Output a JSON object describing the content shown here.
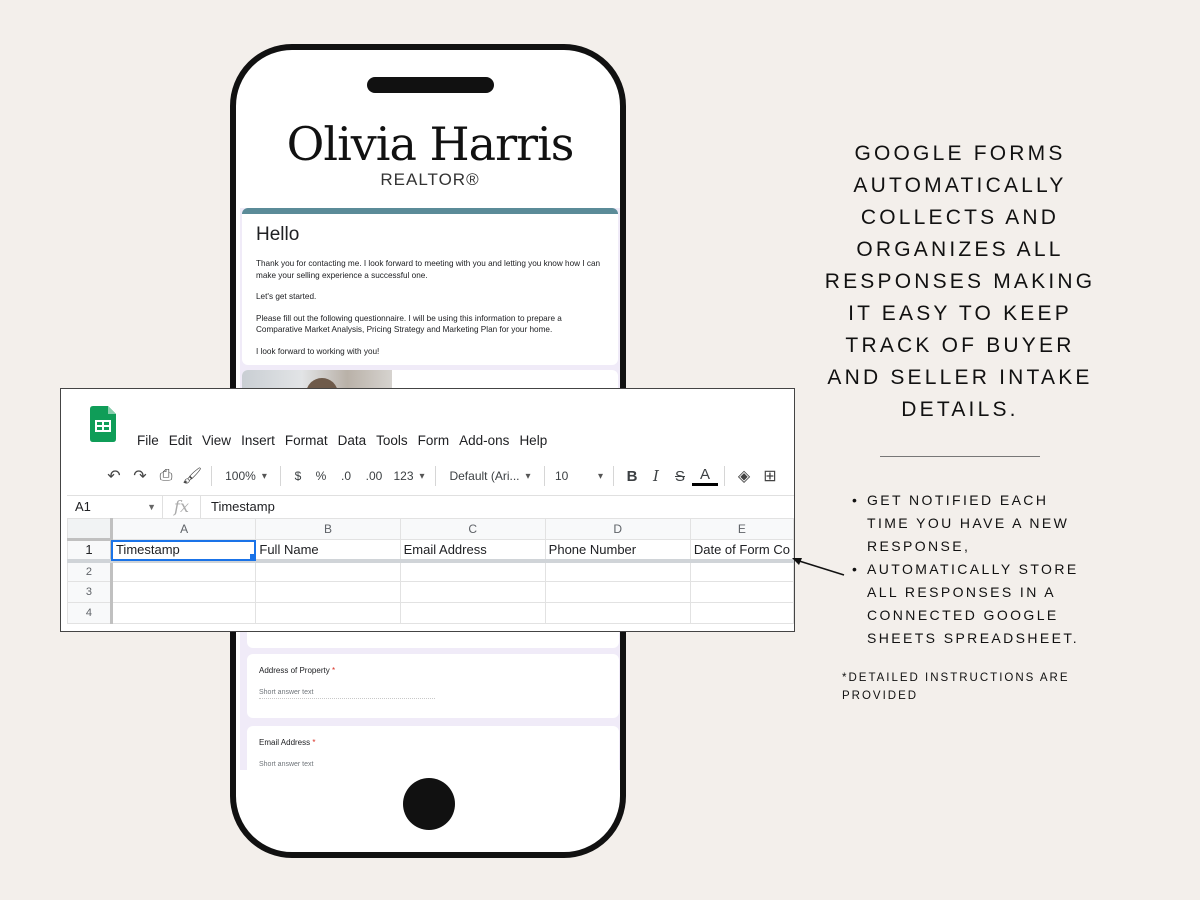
{
  "phone": {
    "brand": {
      "name": "Olivia Harris",
      "title": "REALTOR®"
    },
    "intro": {
      "heading": "Hello",
      "paragraphs": [
        "Thank you for contacting me.  I look forward to meeting with you and letting you know how I can make your selling experience a successful one.",
        "Let's get started.",
        "Please fill out the following questionnaire.  I will be using this information to prepare a Comparative Market Analysis, Pricing Strategy and Marketing Plan for your home.",
        "I look forward to working with you!"
      ]
    },
    "questions": [
      {
        "label": "Address of Property",
        "required_mark": "*",
        "hint": "Short answer text"
      },
      {
        "label": "Email Address",
        "required_mark": "*",
        "hint": "Short answer text"
      }
    ]
  },
  "spreadsheet": {
    "menu": [
      "File",
      "Edit",
      "View",
      "Insert",
      "Format",
      "Data",
      "Tools",
      "Form",
      "Add-ons",
      "Help"
    ],
    "toolbar": {
      "undo_icon": "↶",
      "redo_icon": "↷",
      "print_icon": "⎙",
      "paint_format_icon": "🖌",
      "zoom": "100%",
      "currency": "$",
      "percent": "%",
      "decrease_decimals": ".0",
      "increase_decimals": ".00",
      "number_format": "123",
      "font": "Default (Ari...",
      "font_size": "10",
      "bold": "B",
      "italic": "I",
      "strikethrough": "S",
      "text_color": "A",
      "fill_icon": "◈",
      "borders_icon": "⊞"
    },
    "name_box": "A1",
    "fx": "fx",
    "formula_value": "Timestamp",
    "columns": [
      "A",
      "B",
      "C",
      "D",
      "E"
    ],
    "rows": [
      "1",
      "2",
      "3",
      "4"
    ],
    "header_row": [
      "Timestamp",
      "Full Name",
      "Email Address",
      "Phone Number",
      "Date of Form Co"
    ]
  },
  "right": {
    "headline": "Google Forms automatically collects and organizes all responses making it easy to keep track of buyer and seller intake details.",
    "bullets": [
      "Get notified each time you have a new response,",
      "Automatically store all responses in a connected Google Sheets spreadsheet."
    ],
    "footnote": "*Detailed instructions are provided"
  },
  "colors": {
    "background": "#f3efeb",
    "form_accent": "#5b8b98",
    "sheets_green": "#0f9d58",
    "selection": "#1a73e8"
  }
}
